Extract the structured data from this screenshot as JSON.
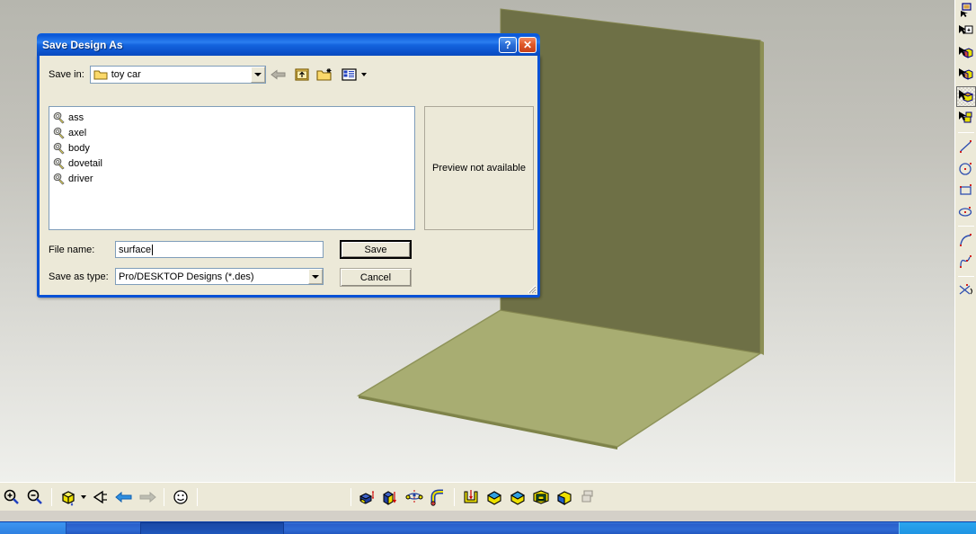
{
  "dialog": {
    "title": "Save Design As",
    "help_button": "?",
    "close_button": "✕",
    "savein_label": "Save in:",
    "savein_value": "toy car",
    "nav_buttons": [
      {
        "name": "back-icon",
        "label": "Back"
      },
      {
        "name": "up-one-level-icon",
        "label": "Up One Level"
      },
      {
        "name": "new-folder-icon",
        "label": "Create New Folder"
      },
      {
        "name": "views-icon",
        "label": "Views"
      }
    ],
    "files": [
      {
        "name": "ass",
        "icon": "cad-design-file-icon"
      },
      {
        "name": "axel",
        "icon": "cad-design-file-icon"
      },
      {
        "name": "body",
        "icon": "cad-design-file-icon"
      },
      {
        "name": "dovetail",
        "icon": "cad-design-file-icon"
      },
      {
        "name": "driver",
        "icon": "cad-design-file-icon"
      }
    ],
    "preview_text": "Preview not available",
    "filename_label": "File name:",
    "filename_value": "surface",
    "filename_placeholder": "",
    "filetype_label": "Save as type:",
    "filetype_value": "Pro/DESKTOP Designs (*.des)",
    "save_label": "Save",
    "cancel_label": "Cancel"
  },
  "viewport": {
    "background_top": "#b6b6ae",
    "background_bottom": "#eff0ec",
    "wall_color": "#6e7046",
    "wall_edge_color": "#8c8f55",
    "floor_color": "#a8ad72",
    "floor_edge_color": "#8e9359",
    "floor_side_color": "#7e8349"
  },
  "bottom_toolbar": {
    "left_group": [
      {
        "name": "zoom-in-icon",
        "label": "Zoom In",
        "state": "normal"
      },
      {
        "name": "zoom-out-icon",
        "label": "Zoom Out",
        "state": "normal"
      }
    ],
    "view_group": [
      {
        "name": "view-cube-icon",
        "label": "View Cube",
        "state": "normal"
      },
      {
        "name": "view-cube-dropdown-icon",
        "label": "View Options",
        "state": "normal"
      },
      {
        "name": "view-direction-icon",
        "label": "View Direction",
        "state": "normal"
      },
      {
        "name": "previous-view-icon",
        "label": "Previous View",
        "state": "normal"
      },
      {
        "name": "next-view-icon",
        "label": "Next View",
        "state": "disabled"
      }
    ],
    "smiley_group": [
      {
        "name": "smiley-icon",
        "label": "Feedback",
        "state": "normal"
      }
    ],
    "feature_group": [
      {
        "name": "extrude-icon",
        "label": "Extrude",
        "state": "normal"
      },
      {
        "name": "subtract-icon",
        "label": "Subtract Material",
        "state": "normal"
      },
      {
        "name": "revolve-icon",
        "label": "Revolve",
        "state": "normal"
      },
      {
        "name": "sweep-icon",
        "label": "Sweep",
        "state": "normal"
      }
    ],
    "solid_group": [
      {
        "name": "mould-icon",
        "label": "Mould",
        "state": "normal"
      },
      {
        "name": "round-edge-icon",
        "label": "Round Edge",
        "state": "normal"
      },
      {
        "name": "chamfer-icon",
        "label": "Chamfer",
        "state": "normal"
      },
      {
        "name": "shell-icon",
        "label": "Shell",
        "state": "normal"
      },
      {
        "name": "taper-icon",
        "label": "Taper",
        "state": "normal"
      },
      {
        "name": "copy-solid-icon",
        "label": "Copy Solid",
        "state": "disabled"
      }
    ]
  },
  "right_toolbar": {
    "items": [
      {
        "name": "select-faces-icon",
        "label": "Select Faces",
        "state": "normal"
      },
      {
        "name": "select-object-icon",
        "label": "Select Object",
        "state": "normal"
      },
      {
        "name": "select-solid-icon",
        "label": "Select Solid",
        "state": "normal"
      },
      {
        "name": "select-material-icon",
        "label": "Select Material",
        "state": "normal"
      },
      {
        "name": "select-shaded-icon",
        "label": "Select Shaded",
        "state": "active"
      },
      {
        "name": "select-group-icon",
        "label": "Select Group",
        "state": "normal"
      },
      {
        "name": "line-tool-icon",
        "label": "Line",
        "state": "normal"
      },
      {
        "name": "circle-tool-icon",
        "label": "Circle",
        "state": "normal"
      },
      {
        "name": "rectangle-tool-icon",
        "label": "Rectangle",
        "state": "normal"
      },
      {
        "name": "ellipse-tool-icon",
        "label": "Ellipse",
        "state": "normal"
      },
      {
        "name": "arc-tool-icon",
        "label": "Arc",
        "state": "normal"
      },
      {
        "name": "spline-tool-icon",
        "label": "Spline",
        "state": "normal"
      },
      {
        "name": "trim-tool-icon",
        "label": "Trim",
        "state": "normal"
      }
    ]
  },
  "taskbar": {
    "start_label": "",
    "task_label": "",
    "tray_label": ""
  }
}
